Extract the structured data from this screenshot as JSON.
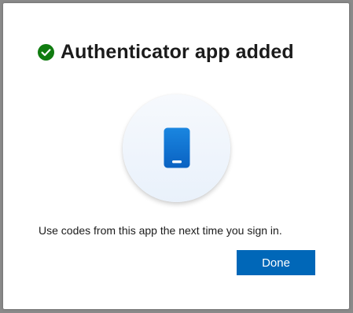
{
  "dialog": {
    "title": "Authenticator app added",
    "status_icon": "checkmark-circle-icon",
    "illustration_icon": "smartphone-icon",
    "message": "Use codes from this app the next time you sign in.",
    "done_label": "Done"
  },
  "colors": {
    "success": "#107c10",
    "accent": "#0067b8",
    "phone": "#0f6cbd"
  }
}
